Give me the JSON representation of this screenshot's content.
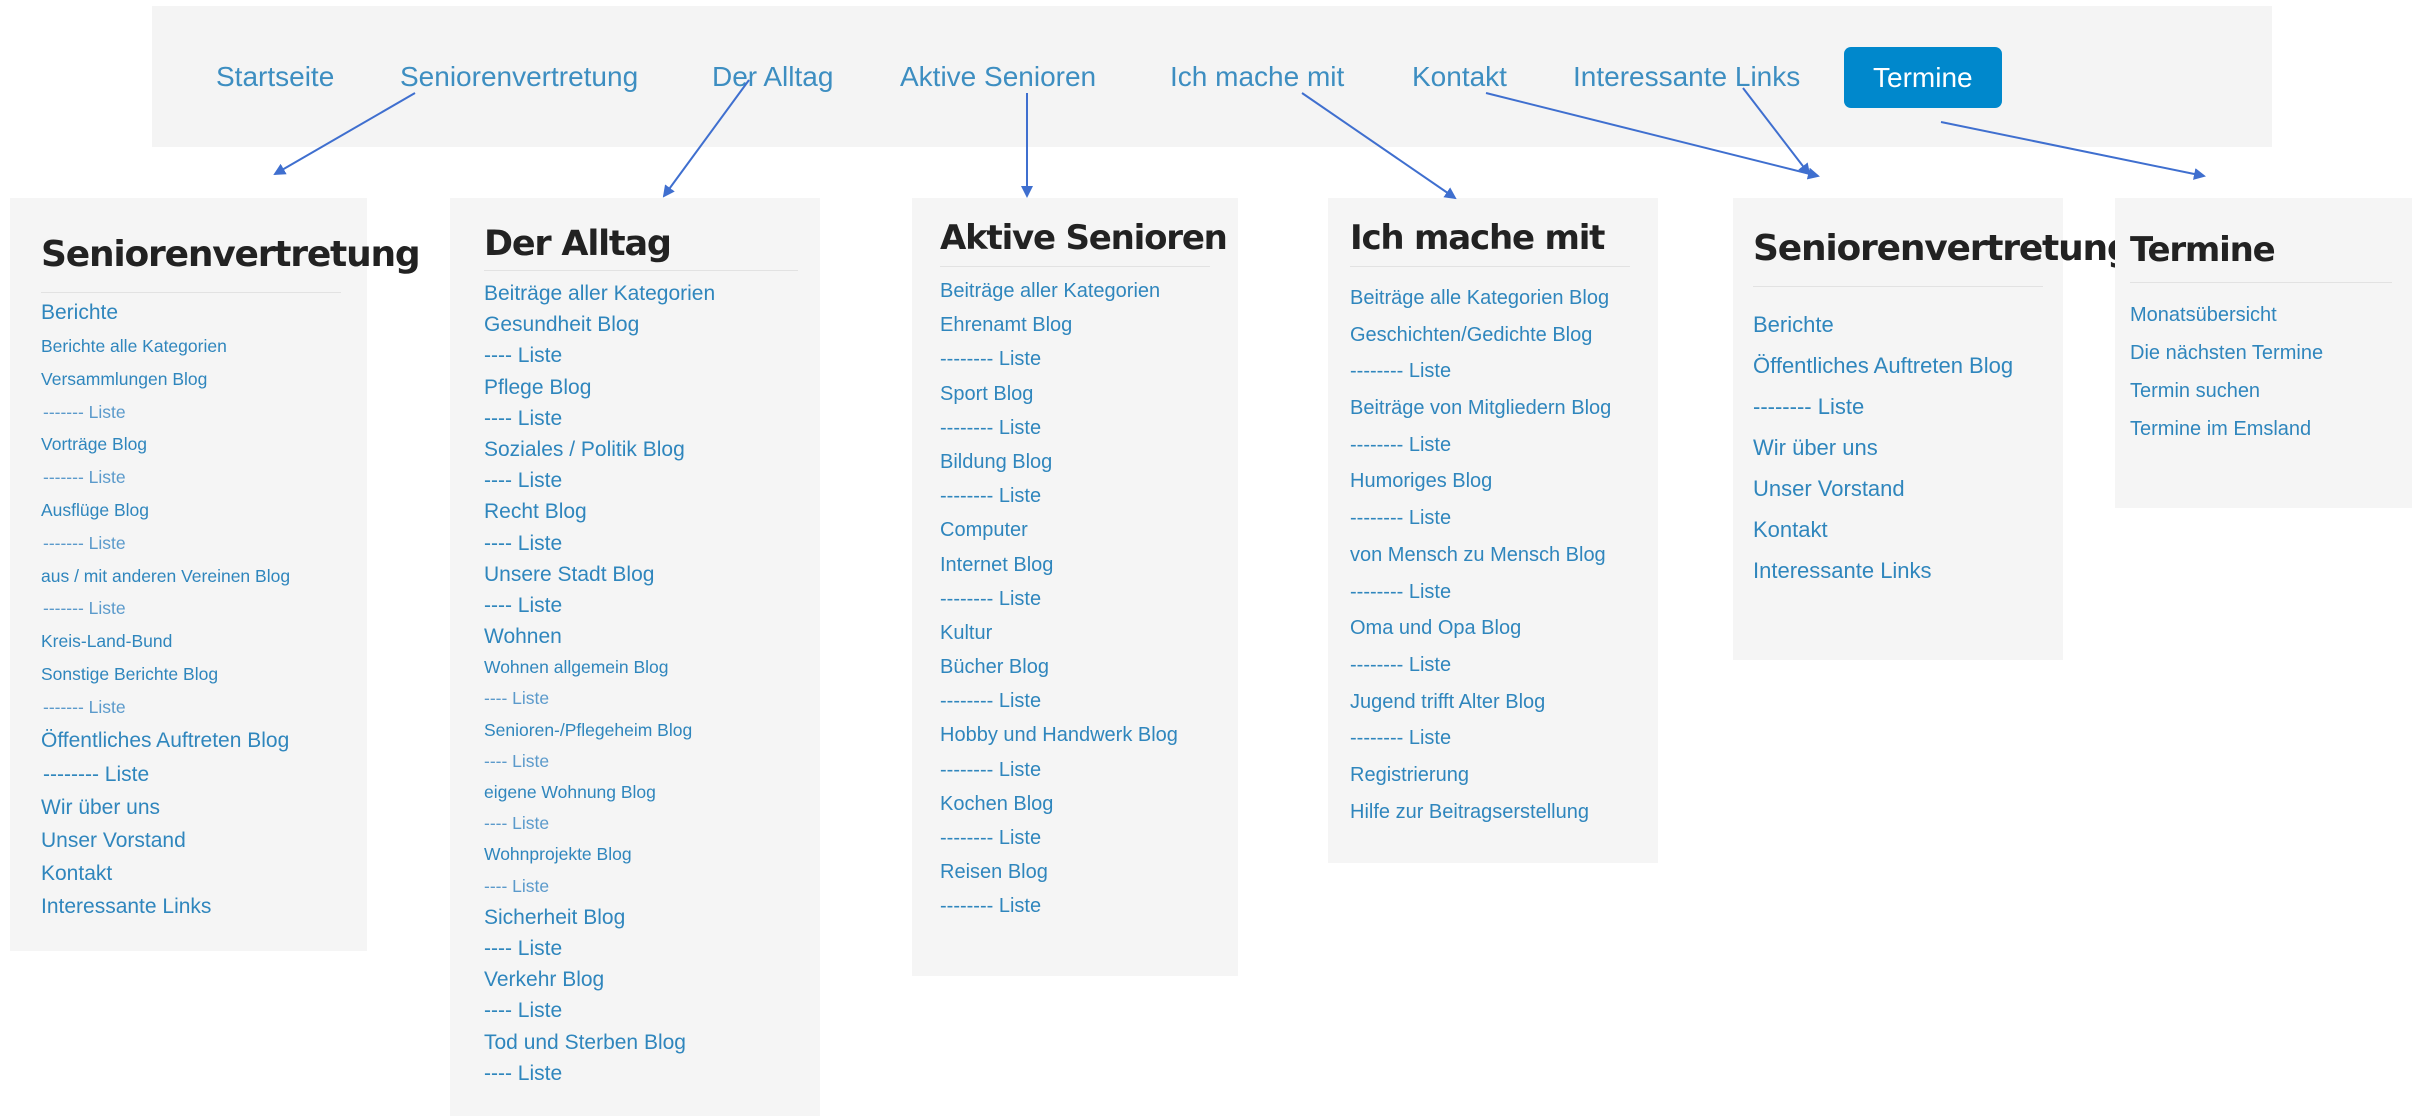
{
  "nav": {
    "items": [
      "Startseite",
      "Seniorenvertretung",
      "Der Alltag",
      "Aktive Senioren",
      "Ich mache mit",
      "Kontakt",
      "Interessante Links"
    ],
    "active": "Termine"
  },
  "panels": {
    "seniorenvertretung_full": {
      "title": "Seniorenvertretung",
      "items": [
        "Berichte",
        "Berichte alle Kategorien",
        "Versammlungen Blog",
        "------- Liste",
        "Vorträge Blog",
        "------- Liste",
        "Ausflüge Blog",
        "------- Liste",
        "aus / mit anderen Vereinen Blog",
        "------- Liste",
        "Kreis-Land-Bund",
        "Sonstige Berichte Blog",
        "------- Liste",
        "Öffentliches Auftreten Blog",
        "-------- Liste",
        "Wir über uns",
        "Unser Vorstand",
        "Kontakt",
        "Interessante Links"
      ]
    },
    "alltag": {
      "title": "Der Alltag",
      "items": [
        "Beiträge aller Kategorien",
        "Gesundheit Blog",
        "---- Liste",
        "Pflege Blog",
        "---- Liste",
        "Soziales / Politik Blog",
        "---- Liste",
        "Recht Blog",
        "---- Liste",
        "Unsere Stadt Blog",
        "---- Liste",
        "Wohnen",
        "Wohnen allgemein Blog",
        "---- Liste",
        "Senioren-/Pflegeheim Blog",
        "---- Liste",
        "eigene Wohnung Blog",
        "---- Liste",
        "Wohnprojekte Blog",
        "---- Liste",
        "Sicherheit Blog",
        "---- Liste",
        "Verkehr Blog",
        "---- Liste",
        "Tod und Sterben Blog",
        "---- Liste"
      ]
    },
    "aktive": {
      "title": "Aktive Senioren",
      "items": [
        "Beiträge aller Kategorien",
        "Ehrenamt Blog",
        "-------- Liste",
        "Sport Blog",
        "-------- Liste",
        "Bildung Blog",
        "-------- Liste",
        "Computer",
        "Internet Blog",
        "-------- Liste",
        "Kultur",
        "Bücher Blog",
        "-------- Liste",
        "Hobby und Handwerk Blog",
        "-------- Liste",
        "Kochen Blog",
        "-------- Liste",
        "Reisen Blog",
        "-------- Liste"
      ]
    },
    "mitmachen": {
      "title": "Ich mache mit",
      "items": [
        "Beiträge alle Kategorien Blog",
        "Geschichten/Gedichte Blog",
        "-------- Liste",
        "Beiträge von Mitgliedern Blog",
        "-------- Liste",
        "Humoriges Blog",
        "-------- Liste",
        "von Mensch zu Mensch Blog",
        "-------- Liste",
        "Oma und Opa Blog",
        "-------- Liste",
        "Jugend trifft Alter Blog",
        "-------- Liste",
        "Registrierung",
        "Hilfe zur Beitragserstellung"
      ]
    },
    "seniorenvertretung_short": {
      "title": "Seniorenvertretung",
      "items": [
        "Berichte",
        "Öffentliches Auftreten Blog",
        "-------- Liste",
        "Wir über uns",
        "Unser Vorstand",
        "Kontakt",
        "Interessante Links"
      ]
    },
    "termine": {
      "title": "Termine",
      "items": [
        "Monatsübersicht",
        "Die nächsten Termine",
        "Termin suchen",
        "Termine im Emsland"
      ]
    }
  },
  "colors": {
    "link": "#2f86bd",
    "arrow": "#3f6fcf",
    "active_tab": "#0088cc",
    "panel_bg": "#f5f5f5",
    "nav_bg": "#f4f4f4"
  }
}
